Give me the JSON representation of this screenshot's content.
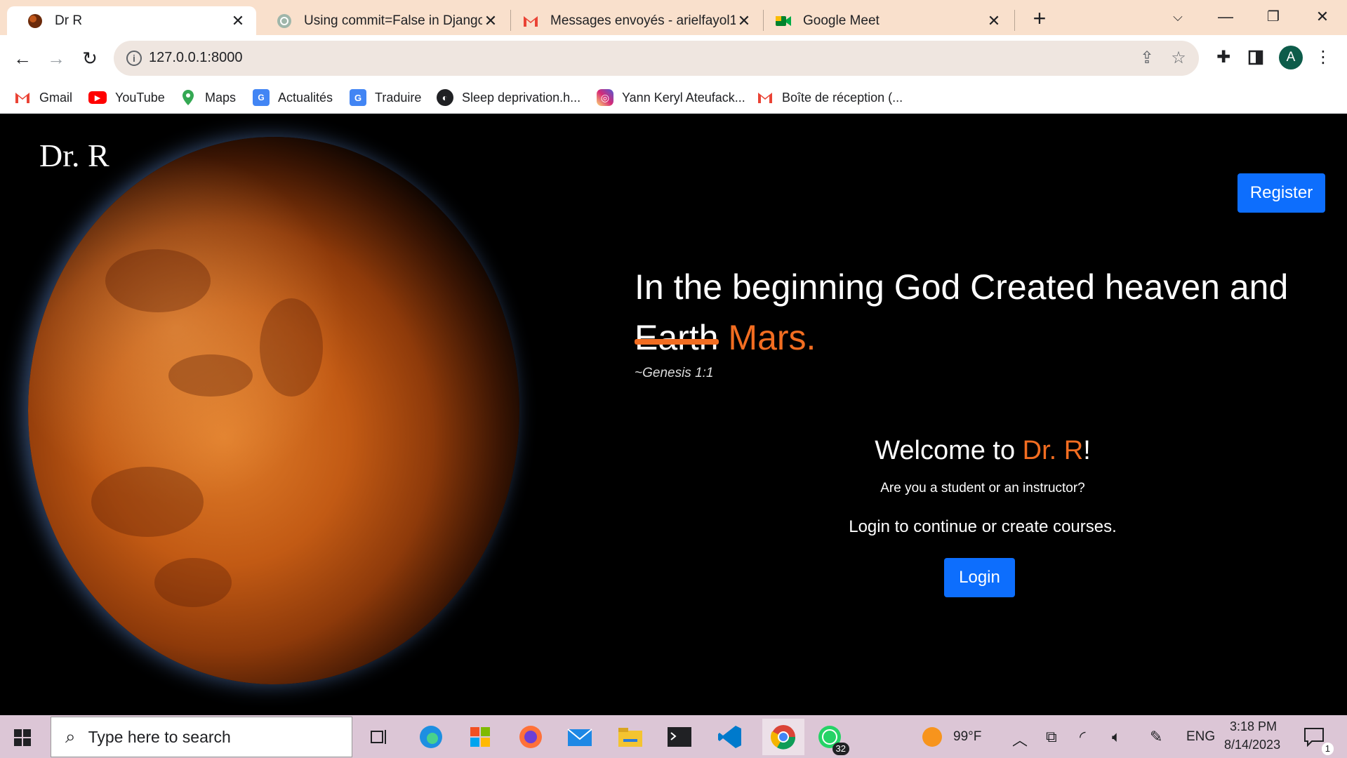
{
  "browser": {
    "tabs": [
      {
        "title": "Dr R",
        "active": true
      },
      {
        "title": "Using commit=False in Django",
        "active": false
      },
      {
        "title": "Messages envoyés - arielfayol1@",
        "active": false
      },
      {
        "title": "Google Meet",
        "active": false
      }
    ],
    "url": "127.0.0.1:8000",
    "avatar_letter": "A",
    "bookmarks": [
      {
        "label": "Gmail",
        "icon": "gmail-icon"
      },
      {
        "label": "YouTube",
        "icon": "youtube-icon"
      },
      {
        "label": "Maps",
        "icon": "maps-icon"
      },
      {
        "label": "Actualités",
        "icon": "news-icon"
      },
      {
        "label": "Traduire",
        "icon": "translate-icon"
      },
      {
        "label": "Sleep deprivation.h...",
        "icon": "globe-icon"
      },
      {
        "label": "Yann Keryl Ateufack...",
        "icon": "instagram-icon"
      },
      {
        "label": "Boîte de réception (...",
        "icon": "gmail-icon"
      }
    ]
  },
  "page": {
    "logo": "Dr. R",
    "register_label": "Register",
    "quote": {
      "line1": "In the beginning God Created heaven and",
      "struck_word": "Earth",
      "highlight_word": "Mars."
    },
    "citation": "~Genesis 1:1",
    "welcome": {
      "prefix": "Welcome to ",
      "brand": "Dr. R",
      "suffix": "!"
    },
    "question": "Are you a student or an instructor?",
    "cta": "Login to continue or create courses.",
    "login_label": "Login"
  },
  "taskbar": {
    "search_placeholder": "Type here to search",
    "whatsapp_badge": "32",
    "weather": "99°F",
    "language": "ENG",
    "time": "3:18 PM",
    "date": "8/14/2023",
    "notification_count": "1"
  },
  "colors": {
    "accent_orange": "#f26d21",
    "button_blue": "#0d6efd",
    "tabstrip": "#f9e0cc"
  }
}
